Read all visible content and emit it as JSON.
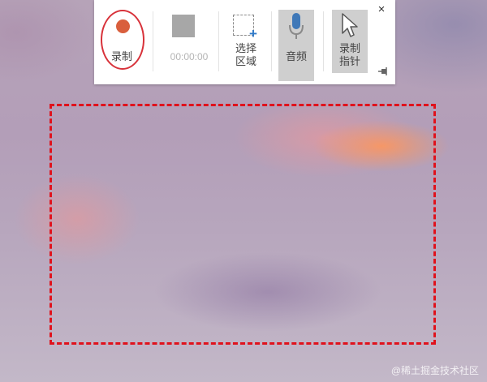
{
  "toolbar": {
    "record_label": "录制",
    "timer_label": "00:00:00",
    "select_area_label": "选择\n区域",
    "audio_label": "音频",
    "record_pointer_label": "录制\n指针",
    "close_symbol": "×"
  },
  "icons": {
    "record": "record-dot-icon",
    "stop": "stop-square-icon",
    "select": "select-area-icon",
    "audio": "microphone-icon",
    "pointer": "mouse-pointer-icon",
    "close": "close-icon",
    "pin": "pin-icon"
  },
  "colors": {
    "selection_border": "#e0121c",
    "record_dot": "#d95f3d",
    "record_ring": "#d8323a",
    "toggle_active_bg": "#cfcfcf",
    "accent_blue": "#2e79c9"
  },
  "watermark": "@稀土掘金技术社区"
}
